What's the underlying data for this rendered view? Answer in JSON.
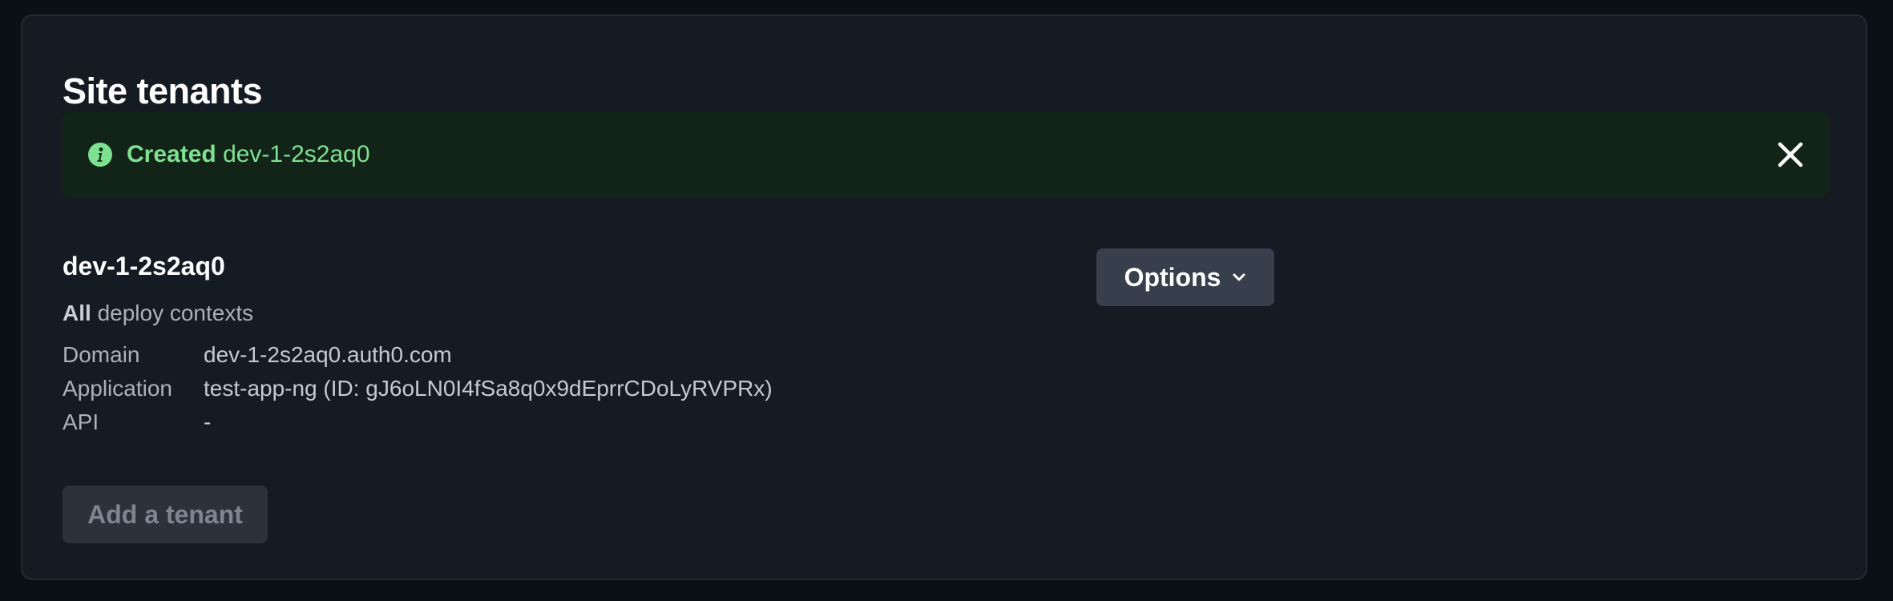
{
  "section": {
    "title": "Site tenants"
  },
  "alert": {
    "status": "Created",
    "message": "dev-1-2s2aq0",
    "icon": "info-circle-icon",
    "accent_color": "#7ee191",
    "background_color": "#122418"
  },
  "tenant": {
    "name": "dev-1-2s2aq0",
    "contexts_strong": "All",
    "contexts_rest": "deploy contexts",
    "details": [
      {
        "label": "Domain",
        "value": "dev-1-2s2aq0.auth0.com"
      },
      {
        "label": "Application",
        "value": "test-app-ng (ID: gJ6oLN0I4fSa8q0x9dEprrCDoLyRVPRx)"
      },
      {
        "label": "API",
        "value": "-"
      }
    ],
    "options_label": "Options"
  },
  "actions": {
    "add_tenant_label": "Add a tenant"
  }
}
